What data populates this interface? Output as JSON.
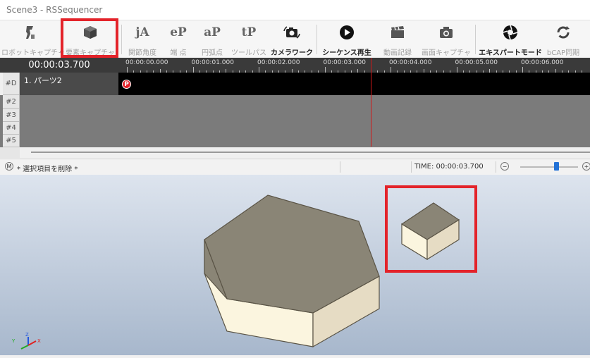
{
  "window": {
    "title": "Scene3 - RSSequencer"
  },
  "toolbar": {
    "items": [
      {
        "label": "ロボットキャプチャ",
        "icon": "robot-capture-icon",
        "active": false
      },
      {
        "label": "要素キャプチャ",
        "icon": "element-capture-icon",
        "active": false
      },
      {
        "label": "関節角度",
        "icon": "joint-angle-icon",
        "glyph": "jA",
        "active": false
      },
      {
        "label": "端 点",
        "icon": "end-point-icon",
        "glyph": "eP",
        "active": false
      },
      {
        "label": "円弧点",
        "icon": "arc-point-icon",
        "glyph": "aP",
        "active": false
      },
      {
        "label": "ツールパス",
        "icon": "tool-path-icon",
        "glyph": "tP",
        "active": false
      },
      {
        "label": "カメラワーク",
        "icon": "camera-work-icon",
        "active": true
      },
      {
        "label": "シーケンス再生",
        "icon": "play-icon",
        "active": true
      },
      {
        "label": "動画記録",
        "icon": "clapper-icon",
        "active": false
      },
      {
        "label": "画面キャプチャ",
        "icon": "camera-icon",
        "active": false
      },
      {
        "label": "エキスパートモード",
        "icon": "aperture-icon",
        "active": true
      },
      {
        "label": "bCAP同期",
        "icon": "sync-icon",
        "active": false
      }
    ]
  },
  "timeline": {
    "current_time": "00:00:03.700",
    "cursor_seconds": 3.7,
    "seconds_per_major_tick": 1.0,
    "ticks": [
      "00:00:00.000",
      "00:00:01.000",
      "00:00:02.000",
      "00:00:03.000",
      "00:00:04.000",
      "00:00:05.000",
      "00:00:06.000"
    ],
    "tracks": [
      {
        "id": "#D",
        "name": "1. パーツ2",
        "marker": "P"
      },
      {
        "id": "#2",
        "name": ""
      },
      {
        "id": "#3",
        "name": ""
      },
      {
        "id": "#4",
        "name": ""
      },
      {
        "id": "#5",
        "name": ""
      }
    ]
  },
  "statusbar": {
    "mode_button": "M",
    "message": "* 選択項目を削除 *",
    "time_label": "TIME: 00:00:03.700",
    "zoom_minus": "−",
    "zoom_plus": "+",
    "zoom_level": 0.62
  },
  "viewport": {
    "axes": {
      "x": "X",
      "y": "Y",
      "z": "Z"
    },
    "colors": {
      "top_face": "#8a8576",
      "light_face": "#fbf5df",
      "side_face": "#e6dcc4",
      "selection": "#e3232a"
    }
  }
}
